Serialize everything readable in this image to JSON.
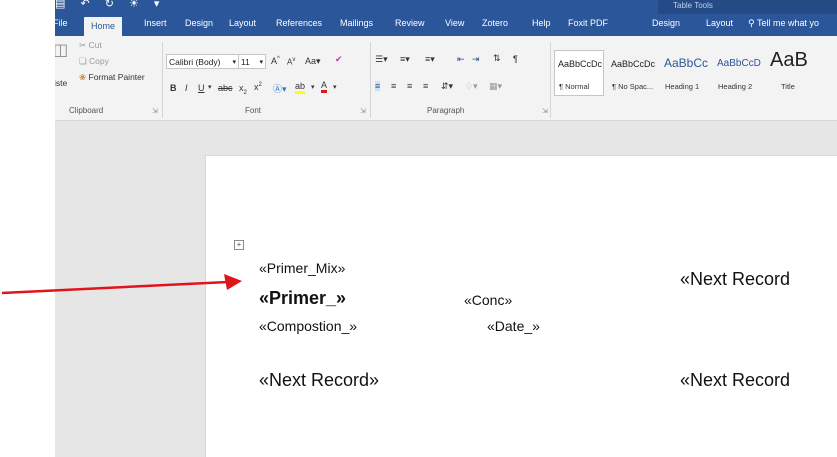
{
  "qat_glyphs": "▤ ↶ ↻ ☀ ▾",
  "contextual_label": "Table Tools",
  "tabs": [
    "File",
    "Home",
    "Insert",
    "Design",
    "Layout",
    "References",
    "Mailings",
    "Review",
    "View",
    "Zotero",
    "Help",
    "Foxit PDF",
    "Design",
    "Layout"
  ],
  "tell_me": "Tell me what yo",
  "clipboard": {
    "paste_label": "iste",
    "cut_label": "Cut",
    "copy_label": "Copy",
    "format_painter_label": "Format Painter",
    "group_label": "Clipboard"
  },
  "font": {
    "family_value": "Calibri (Body)",
    "size_value": "11",
    "group_label": "Font"
  },
  "paragraph": {
    "group_label": "Paragraph"
  },
  "styles": [
    {
      "sample": "AaBbCcDc",
      "name": "¶ Normal"
    },
    {
      "sample": "AaBbCcDc",
      "name": "¶ No Spac..."
    },
    {
      "sample": "AaBbCc",
      "name": "Heading 1"
    },
    {
      "sample": "AaBbCcD",
      "name": "Heading 2"
    },
    {
      "sample": "AaB",
      "name": "Title"
    }
  ],
  "document": {
    "fields": {
      "primer_mix": "«Primer_Mix»",
      "primer": "«Primer_»",
      "conc": "«Conc»",
      "composition": "«Compostion_»",
      "date": "«Date_»",
      "next_record_1": "«Next Record",
      "next_record_2": "«Next Record»",
      "next_record_3": "«Next Record"
    }
  },
  "colors": {
    "brand_blue": "#2b579a",
    "annotation_arrow": "#e0151b"
  }
}
